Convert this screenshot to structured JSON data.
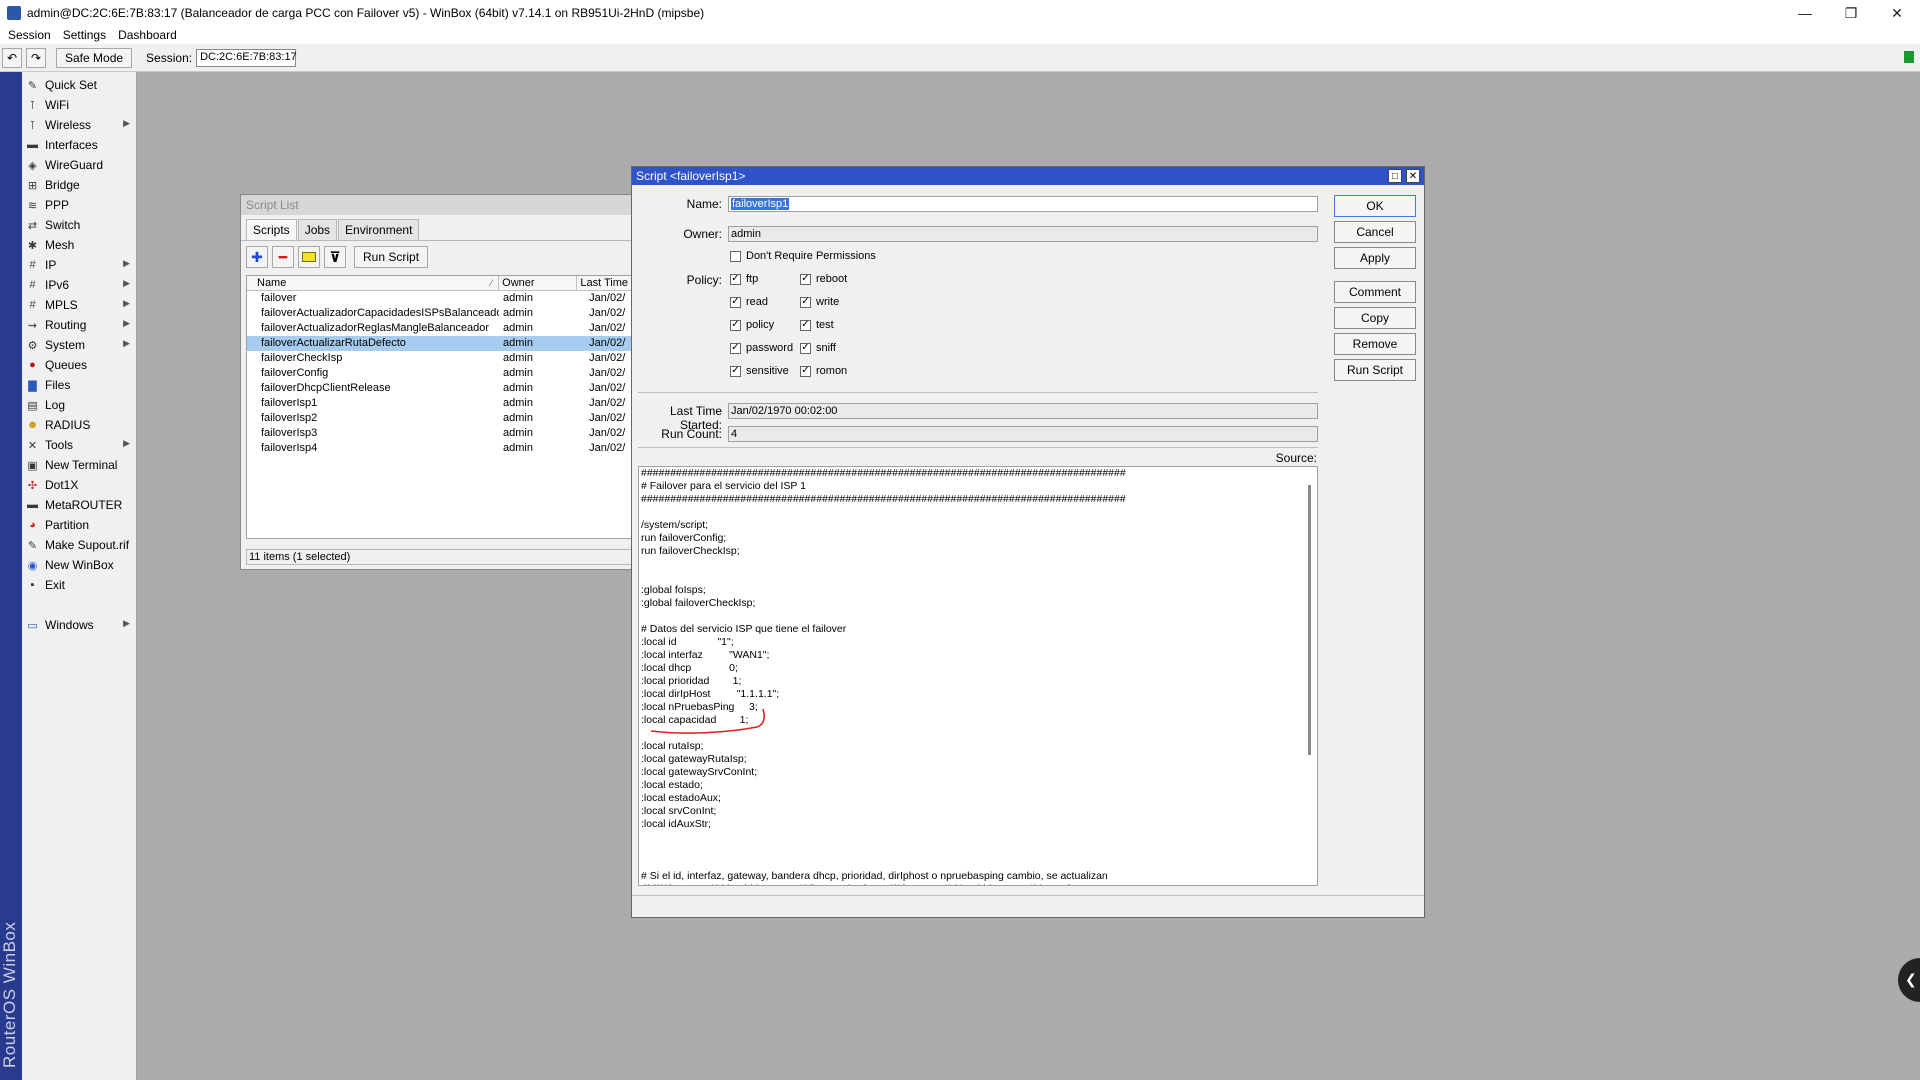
{
  "window": {
    "title": "admin@DC:2C:6E:7B:83:17 (Balanceador de carga PCC con Failover v5) - WinBox (64bit) v7.14.1 on RB951Ui-2HnD (mipsbe)",
    "min_glyph": "—",
    "max_glyph": "❐",
    "close_glyph": "✕"
  },
  "menubar": {
    "session": "Session",
    "settings": "Settings",
    "dashboard": "Dashboard"
  },
  "toolbar": {
    "undo_glyph": "↶",
    "redo_glyph": "↷",
    "safe_mode": "Safe Mode",
    "session_label": "Session:",
    "session_value": "DC:2C:6E:7B:83:17",
    "connected_color": "#1a9a2e"
  },
  "branding": {
    "text": "RouterOS WinBox"
  },
  "sidemenu": {
    "items": [
      {
        "label": "Quick Set",
        "icon": "wand-icon"
      },
      {
        "label": "WiFi",
        "icon": "wifi-icon"
      },
      {
        "label": "Wireless",
        "icon": "wireless-icon"
      },
      {
        "label": "Interfaces",
        "icon": "interfaces-icon"
      },
      {
        "label": "WireGuard",
        "icon": "wireguard-icon"
      },
      {
        "label": "Bridge",
        "icon": "bridge-icon"
      },
      {
        "label": "PPP",
        "icon": "ppp-icon"
      },
      {
        "label": "Switch",
        "icon": "switch-icon"
      },
      {
        "label": "Mesh",
        "icon": "mesh-icon"
      },
      {
        "label": "IP",
        "icon": "ip-icon"
      },
      {
        "label": "IPv6",
        "icon": "ipv6-icon"
      },
      {
        "label": "MPLS",
        "icon": "mpls-icon"
      },
      {
        "label": "Routing",
        "icon": "routing-icon"
      },
      {
        "label": "System",
        "icon": "system-icon"
      },
      {
        "label": "Queues",
        "icon": "queues-icon"
      },
      {
        "label": "Files",
        "icon": "files-icon"
      },
      {
        "label": "Log",
        "icon": "log-icon"
      },
      {
        "label": "RADIUS",
        "icon": "radius-icon"
      },
      {
        "label": "Tools",
        "icon": "tools-icon"
      },
      {
        "label": "New Terminal",
        "icon": "terminal-icon"
      },
      {
        "label": "Dot1X",
        "icon": "dot1x-icon"
      },
      {
        "label": "MetaROUTER",
        "icon": "metarouter-icon"
      },
      {
        "label": "Partition",
        "icon": "partition-icon"
      },
      {
        "label": "Make Supout.rif",
        "icon": "supout-icon"
      },
      {
        "label": "New WinBox",
        "icon": "winbox-icon"
      },
      {
        "label": "Exit",
        "icon": "exit-icon"
      },
      {
        "label": "Windows",
        "icon": "windows-icon"
      }
    ],
    "submenu_glyph": "▶"
  },
  "script_list": {
    "title": "Script List",
    "tabs": [
      "Scripts",
      "Jobs",
      "Environment"
    ],
    "run_script": "Run Script",
    "add_glyph": "✚",
    "remove_glyph": "━",
    "filter_glyph": "⊽",
    "columns": {
      "name": "Name",
      "owner": "Owner",
      "last": "Last Time",
      "sort_glyph": "⁄"
    },
    "rows": [
      {
        "name": "failover",
        "owner": "admin",
        "last": "Jan/02/"
      },
      {
        "name": "failoverActualizadorCapacidadesISPsBalanceador",
        "owner": "admin",
        "last": "Jan/02/"
      },
      {
        "name": "failoverActualizadorReglasMangleBalanceador",
        "owner": "admin",
        "last": "Jan/02/"
      },
      {
        "name": "failoverActualizarRutaDefecto",
        "owner": "admin",
        "last": "Jan/02/"
      },
      {
        "name": "failoverCheckIsp",
        "owner": "admin",
        "last": "Jan/02/"
      },
      {
        "name": "failoverConfig",
        "owner": "admin",
        "last": "Jan/02/"
      },
      {
        "name": "failoverDhcpClientRelease",
        "owner": "admin",
        "last": "Jan/02/"
      },
      {
        "name": "failoverIsp1",
        "owner": "admin",
        "last": "Jan/02/"
      },
      {
        "name": "failoverIsp2",
        "owner": "admin",
        "last": "Jan/02/"
      },
      {
        "name": "failoverIsp3",
        "owner": "admin",
        "last": "Jan/02/"
      },
      {
        "name": "failoverIsp4",
        "owner": "admin",
        "last": "Jan/02/"
      }
    ],
    "status": "11 items (1 selected)"
  },
  "script_editor": {
    "title": "Script <failoverIsp1>",
    "maximize_glyph": "□",
    "close_glyph": "✕",
    "name_label": "Name:",
    "name_value": "failoverIsp1",
    "owner_label": "Owner:",
    "owner_value": "admin",
    "dont_require": "Don't Require Permissions",
    "policy_label": "Policy:",
    "check_glyph": "✓",
    "policies_left": [
      "ftp",
      "read",
      "policy",
      "password",
      "sensitive"
    ],
    "policies_right": [
      "reboot",
      "write",
      "test",
      "sniff",
      "romon"
    ],
    "last_started_label": "Last Time Started:",
    "last_started_value": "Jan/02/1970 00:02:00",
    "run_count_label": "Run Count:",
    "run_count_value": "4",
    "source_label": "Source:",
    "buttons": {
      "ok": "OK",
      "cancel": "Cancel",
      "apply": "Apply",
      "comment": "Comment",
      "copy": "Copy",
      "remove": "Remove",
      "run_script": "Run Script"
    },
    "source": "###################################################################################\n# Failover para el servicio del ISP 1\n###################################################################################\n\n/system/script;\nrun failoverConfig;\nrun failoverCheckIsp;\n\n\n:global foIsps;\n:global failoverCheckIsp;\n\n# Datos del servicio ISP que tiene el failover\n:local id              \"1\";\n:local interfaz         \"WAN1\";\n:local dhcp             0;\n:local prioridad        1;\n:local dirIpHost         \"1.1.1.1\";\n:local nPruebasPing     3;\n:local capacidad        1;\n\n:local rutaIsp;\n:local gatewayRutaIsp;\n:local gatewaySrvConInt;\n:local estado;\n:local estadoAux;\n:local srvConInt;\n:local idAuxStr;\n\n\n\n# Si el id, interfaz, gateway, bandera dhcp, prioridad, dirIphost o npruebasping cambio, se actualizan\n:if ((($foIsps->\"$id\")->\"id\")         != $id)          do={ :set (($foIsps->\"$id\")->\"id\")            $id;        };"
  },
  "colors": {
    "accent": "#2f53c9",
    "selection": "#a6cdf0",
    "annotation_red": "#e02020"
  }
}
